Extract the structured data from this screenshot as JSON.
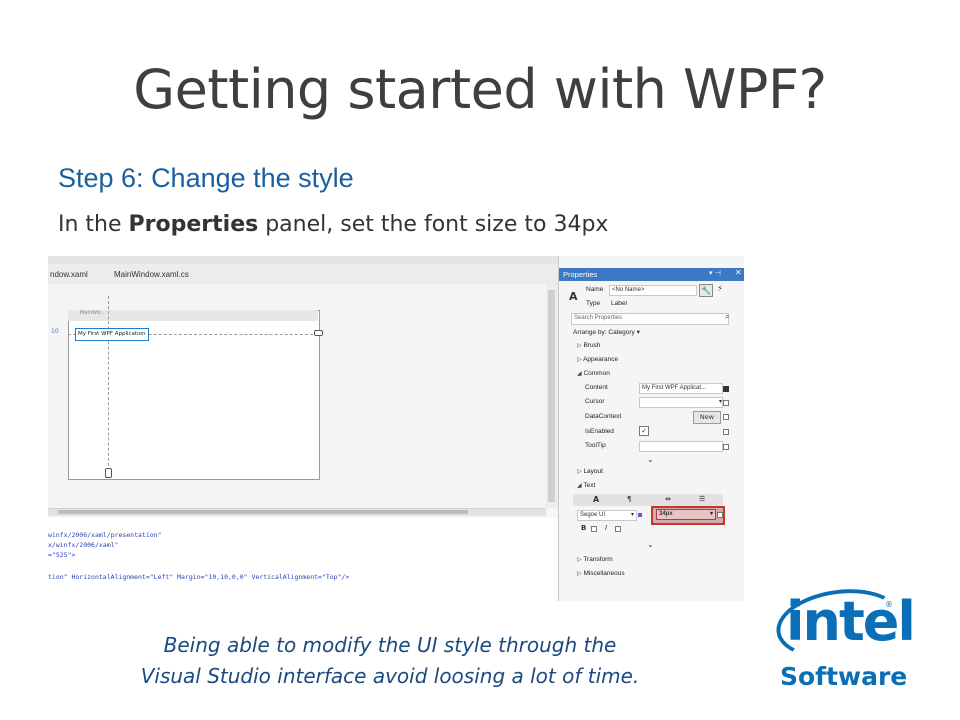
{
  "slide": {
    "title": "Getting started with WPF?",
    "step_title": "Step 6: Change the style",
    "instruction_pre": "In the ",
    "instruction_bold": "Properties",
    "instruction_post": " panel, set the font size to 34px",
    "caption_line1": "Being able to modify the UI style through the",
    "caption_line2": "Visual Studio interface avoid loosing a lot of time."
  },
  "designer": {
    "tabs": [
      "ndow.xaml",
      "MainWindow.xaml.cs"
    ],
    "window_title": "MainWin...",
    "selected_label": "My First WPF Application",
    "margin_value": "10",
    "xaml_lines": [
      "winfx/2006/xaml/presentation\"",
      "x/winfx/2006/xaml\"",
      "=\"525\">",
      "tion\" HorizontalAlignment=\"Left\" Margin=\"10,10,0,0\" VerticalAlignment=\"Top\"/>"
    ]
  },
  "properties": {
    "header": "Properties",
    "name_label": "Name",
    "name_value": "<No Name>",
    "type_label": "Type",
    "type_value": "Label",
    "search_placeholder": "Search Properties",
    "arrange_by": "Arrange by: Category",
    "sections": {
      "brush": "Brush",
      "appearance": "Appearance",
      "common": "Common",
      "layout": "Layout",
      "text": "Text",
      "transform": "Transform",
      "miscellaneous": "Miscellaneous"
    },
    "common_rows": {
      "content_label": "Content",
      "content_value": "My First WPF Applicat...",
      "cursor_label": "Cursor",
      "datacontext_label": "DataContext",
      "new_button": "New",
      "isenabled_label": "IsEnabled",
      "isenabled_checked": true,
      "tooltip_label": "ToolTip"
    },
    "text_rows": {
      "font_family": "Segoe UI",
      "font_size": "34px",
      "bold": "B",
      "italic": "I"
    }
  },
  "logo": {
    "word": "intel",
    "sub": "Software",
    "trademark": "®"
  },
  "colors": {
    "accent": "#1a5fa0",
    "caption": "#1a4a80",
    "intel_blue": "#0a6fb7",
    "highlight_border": "#c0392b",
    "panel_header": "#3c78c3"
  }
}
